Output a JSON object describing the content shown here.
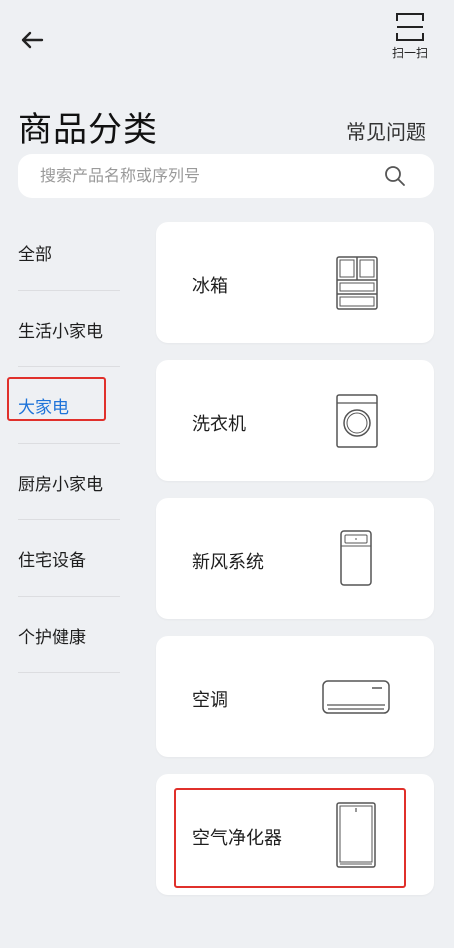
{
  "header": {
    "back_icon": "arrow-left-icon",
    "scan_icon": "scan-icon",
    "scan_label": "扫一扫"
  },
  "page": {
    "title": "商品分类",
    "faq_label": "常见问题"
  },
  "search": {
    "placeholder": "搜索产品名称或序列号",
    "icon": "search-icon"
  },
  "sidebar": {
    "items": [
      {
        "label": "全部",
        "active": false
      },
      {
        "label": "生活小家电",
        "active": false
      },
      {
        "label": "大家电",
        "active": true
      },
      {
        "label": "厨房小家电",
        "active": false
      },
      {
        "label": "住宅设备",
        "active": false
      },
      {
        "label": "个护健康",
        "active": false
      }
    ]
  },
  "categories": [
    {
      "label": "冰箱",
      "icon": "fridge-icon"
    },
    {
      "label": "洗衣机",
      "icon": "washing-machine-icon"
    },
    {
      "label": "新风系统",
      "icon": "fresh-air-system-icon"
    },
    {
      "label": "空调",
      "icon": "air-conditioner-icon"
    },
    {
      "label": "空气净化器",
      "icon": "air-purifier-icon"
    }
  ],
  "colors": {
    "background": "#eef0f3",
    "active": "#1e73d9",
    "highlight": "#e0302b",
    "card": "#ffffff"
  }
}
